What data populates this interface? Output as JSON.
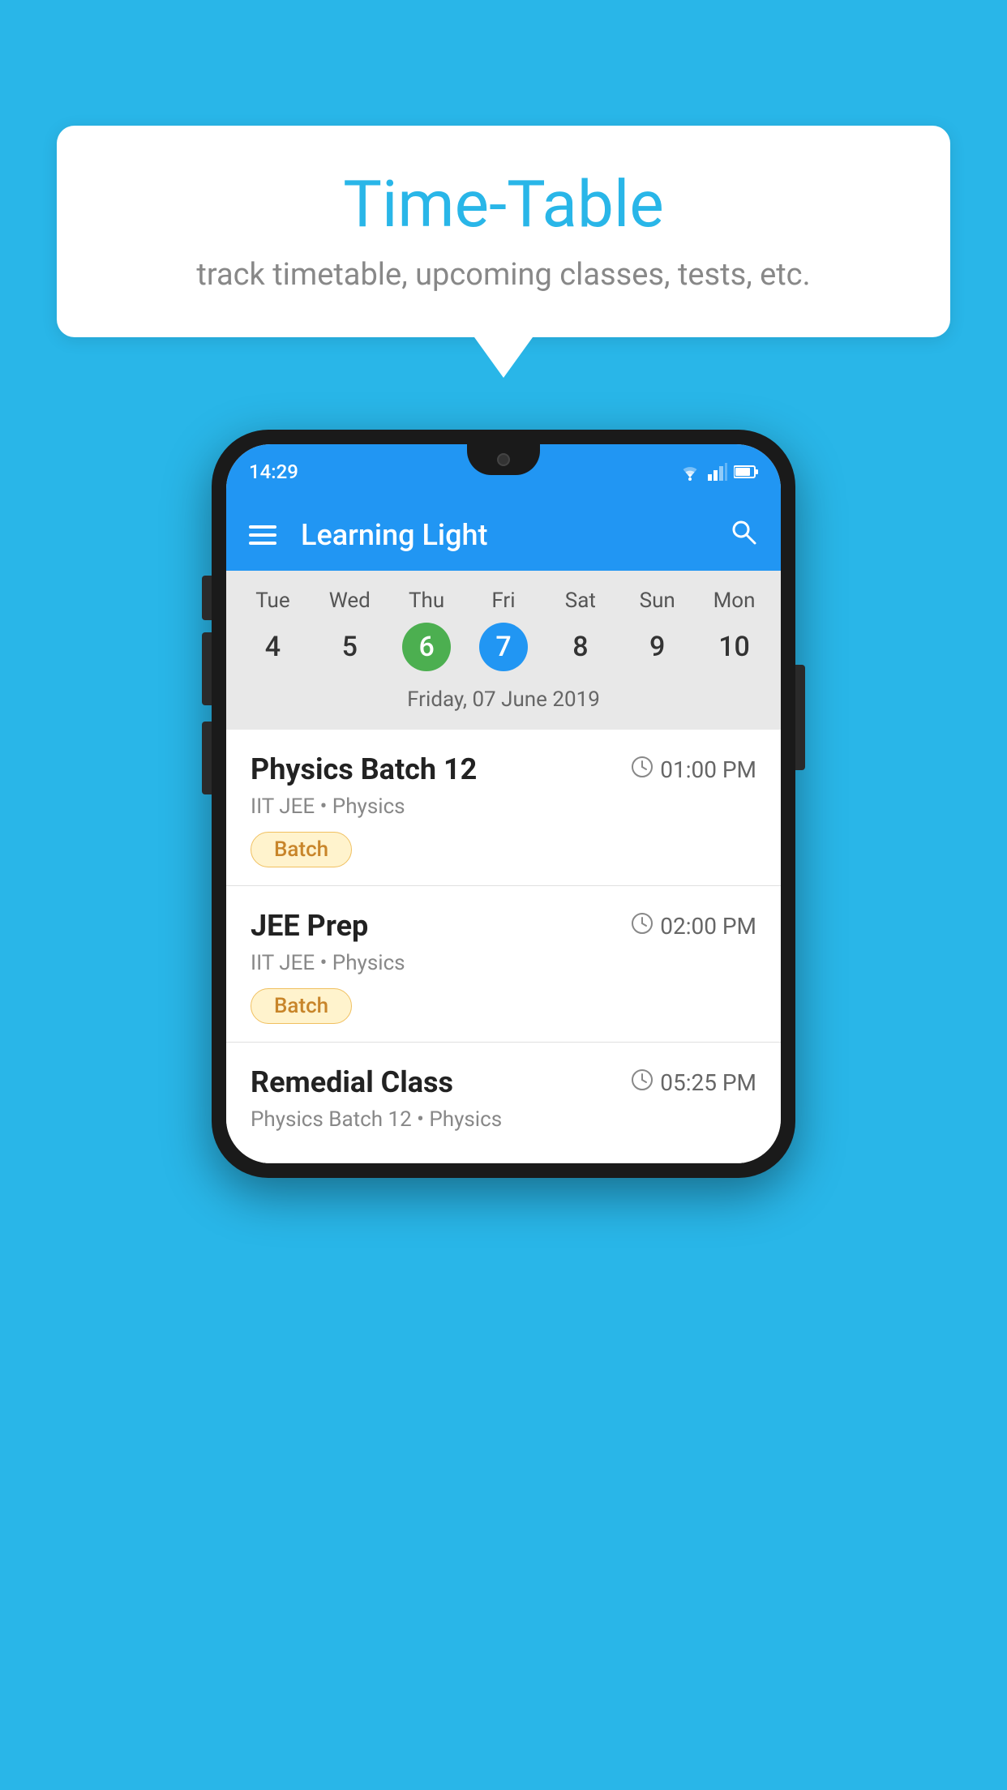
{
  "background_color": "#29b6e8",
  "speech_bubble": {
    "title": "Time-Table",
    "subtitle": "track timetable, upcoming classes, tests, etc."
  },
  "phone": {
    "status_bar": {
      "time": "14:29"
    },
    "app_bar": {
      "title": "Learning Light"
    },
    "calendar": {
      "day_labels": [
        "Tue",
        "Wed",
        "Thu",
        "Fri",
        "Sat",
        "Sun",
        "Mon"
      ],
      "day_numbers": [
        "4",
        "5",
        "6",
        "7",
        "8",
        "9",
        "10"
      ],
      "today_index": 2,
      "selected_index": 3,
      "selected_date_label": "Friday, 07 June 2019"
    },
    "classes": [
      {
        "name": "Physics Batch 12",
        "time": "01:00 PM",
        "meta": "IIT JEE • Physics",
        "badge": "Batch"
      },
      {
        "name": "JEE Prep",
        "time": "02:00 PM",
        "meta": "IIT JEE • Physics",
        "badge": "Batch"
      },
      {
        "name": "Remedial Class",
        "time": "05:25 PM",
        "meta": "Physics Batch 12 • Physics",
        "badge": null
      }
    ]
  }
}
